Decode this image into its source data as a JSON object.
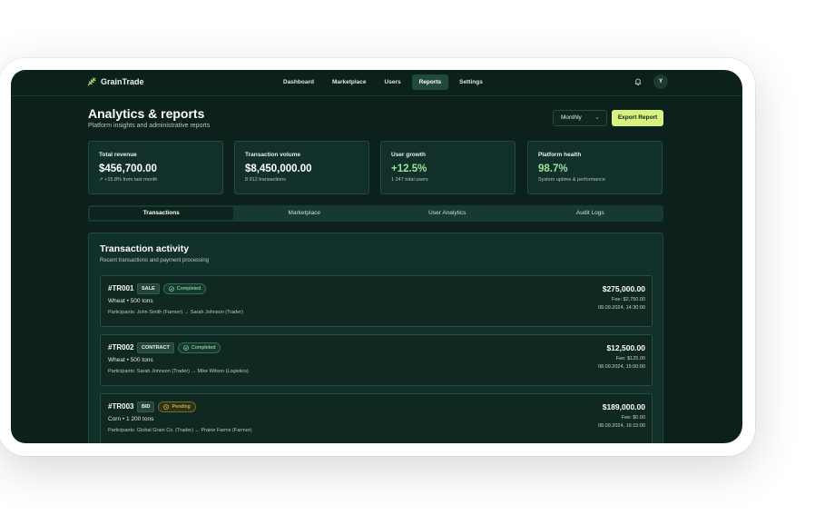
{
  "app": {
    "name": "GrainTrade"
  },
  "nav": {
    "items": [
      {
        "label": "Dashboard",
        "active": false
      },
      {
        "label": "Marketplace",
        "active": false
      },
      {
        "label": "Users",
        "active": false
      },
      {
        "label": "Reports",
        "active": true
      },
      {
        "label": "Settings",
        "active": false
      }
    ]
  },
  "user": {
    "initial": "Y"
  },
  "header": {
    "title": "Analytics & reports",
    "subtitle": "Platform insights and administrative reports",
    "period_select": "Monthly",
    "export_label": "Export Report"
  },
  "stats": [
    {
      "label": "Total revenue",
      "value": "$456,700.00",
      "note": "↗ +15.8% from last month"
    },
    {
      "label": "Transaction volume",
      "value": "$8,450,000.00",
      "note": "8 912 transactions"
    },
    {
      "label": "User growth",
      "value": "+12.5%",
      "note": "1 247 total users"
    },
    {
      "label": "Platform health",
      "value": "98.7%",
      "note": "System uptime & performance"
    }
  ],
  "tabs": [
    {
      "label": "Transactions",
      "active": true
    },
    {
      "label": "Marketplace",
      "active": false
    },
    {
      "label": "User Analytics",
      "active": false
    },
    {
      "label": "Audit Logs",
      "active": false
    }
  ],
  "activity": {
    "title": "Transaction activity",
    "subtitle": "Recent transactions and payment processing",
    "transactions": [
      {
        "id": "#TR001",
        "type": "SALE",
        "status": "Completed",
        "product": "Wheat • 500 tons",
        "participants": "Participants: John Smith (Farmer) → Sarah Johnson (Trader)",
        "amount": "$275,000.00",
        "fee": "Fee: $2,750.00",
        "date": "08.09.2024, 14:30:00"
      },
      {
        "id": "#TR002",
        "type": "CONTRACT",
        "status": "Completed",
        "product": "Wheat • 500 tons",
        "participants": "Participants: Sarah Johnson (Trader) → Mike Wilson (Logistics)",
        "amount": "$12,500.00",
        "fee": "Fee: $125.00",
        "date": "08.09.2024, 15:00:00"
      },
      {
        "id": "#TR003",
        "type": "BID",
        "status": "Pending",
        "product": "Corn • 1 200 tons",
        "participants": "Participants: Global Grain Co. (Trader) → Prairie Farms (Farmer)",
        "amount": "$189,000.00",
        "fee": "Fee: $0.00",
        "date": "08.09.2024, 16:15:00"
      }
    ]
  }
}
